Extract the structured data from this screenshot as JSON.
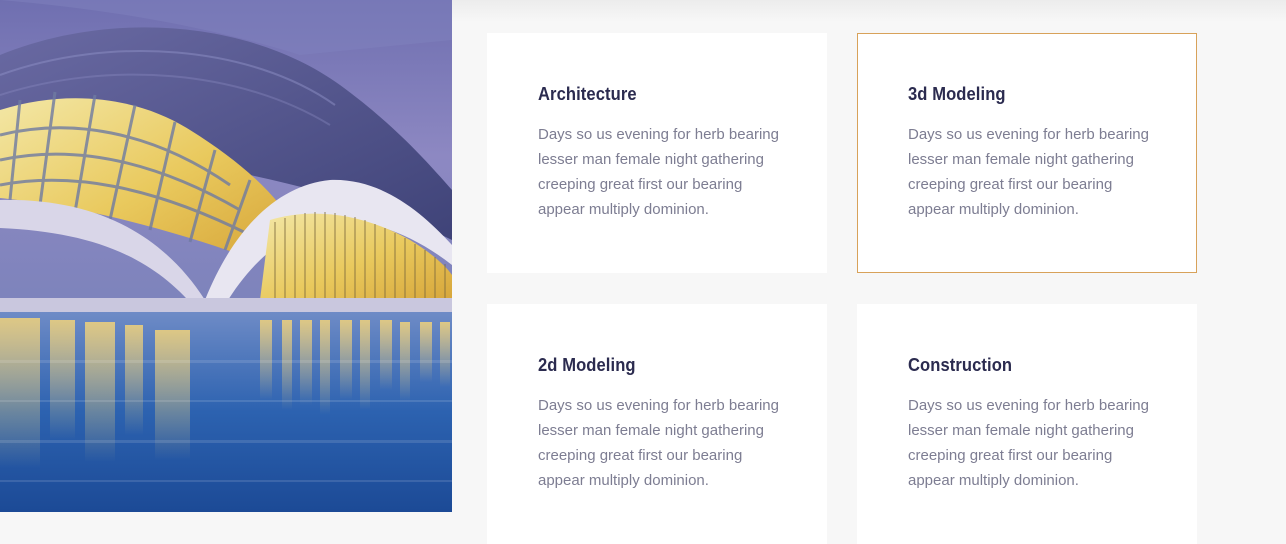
{
  "hero": {
    "image_alt": "City of Arts and Sciences building at dusk"
  },
  "cards": [
    {
      "title": "Architecture",
      "text": "Days so us evening for herb bearing lesser man female night gathering creeping great first our bearing appear multiply dominion."
    },
    {
      "title": "3d Modeling",
      "text": "Days so us evening for herb bearing lesser man female night gathering creeping great first our bearing appear multiply dominion."
    },
    {
      "title": "2d Modeling",
      "text": "Days so us evening for herb bearing lesser man female night gathering creeping great first our bearing appear multiply dominion."
    },
    {
      "title": "Construction",
      "text": "Days so us evening for herb bearing lesser man female night gathering creeping great first our bearing appear multiply dominion."
    }
  ],
  "colors": {
    "page_background": "#f7f7f7",
    "card_background": "#ffffff",
    "active_border": "#d8a25a",
    "title": "#2b2b4f",
    "body_text": "#7d7d92"
  }
}
